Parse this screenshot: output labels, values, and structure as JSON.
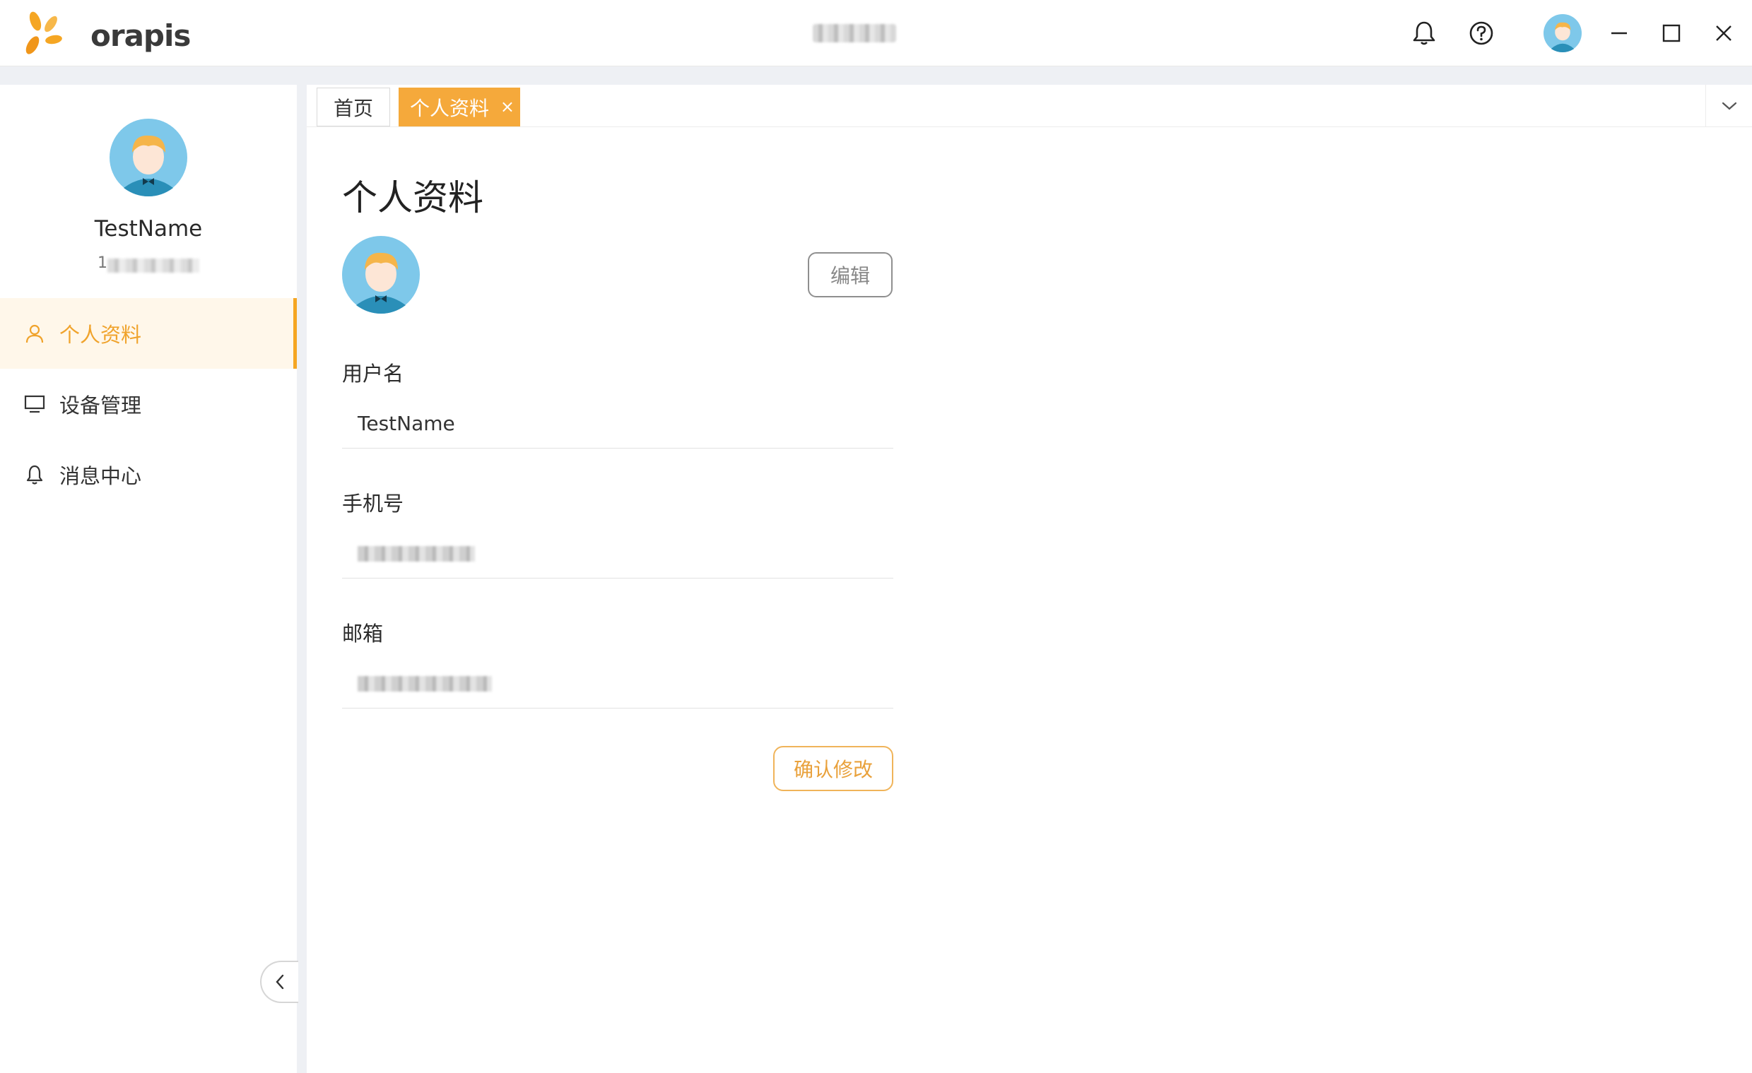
{
  "app": {
    "logo_text": "orapis",
    "window_title": "",
    "colors": {
      "accent": "#f5a623",
      "accent_light": "#fff7ea",
      "tab_active": "#f5a93b"
    }
  },
  "titlebar": {
    "icons": [
      "bell-icon",
      "help-icon",
      "avatar",
      "minimize-icon",
      "maximize-icon",
      "close-icon"
    ]
  },
  "sidebar": {
    "user_name": "TestName",
    "user_phone_prefix": "1",
    "items": [
      {
        "label": "个人资料",
        "icon": "user-icon",
        "active": true
      },
      {
        "label": "设备管理",
        "icon": "monitor-icon",
        "active": false
      },
      {
        "label": "消息中心",
        "icon": "bell-icon",
        "active": false
      }
    ]
  },
  "tabs": [
    {
      "label": "首页",
      "active": false
    },
    {
      "label": "个人资料",
      "active": true,
      "close": "×"
    }
  ],
  "profile": {
    "title": "个人资料",
    "edit_label": "编辑",
    "fields": [
      {
        "label": "用户名",
        "value": "TestName"
      },
      {
        "label": "手机号",
        "value": ""
      },
      {
        "label": "邮箱",
        "value": ""
      }
    ],
    "confirm_label": "确认修改"
  }
}
